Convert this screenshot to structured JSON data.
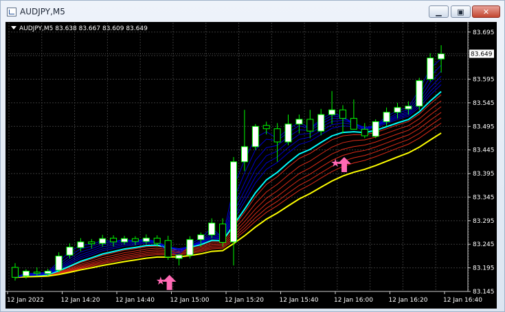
{
  "window": {
    "title": "AUDJPY,M5",
    "buttons": [
      "minimize",
      "maximize",
      "close"
    ]
  },
  "chart": {
    "info_text": "AUDJPY,M5  83.638 83.667 83.609 83.649",
    "current_price_label": "83.649"
  },
  "chart_data": {
    "type": "candlestick",
    "symbol": "AUDJPY",
    "timeframe": "M5",
    "ohlc_header": {
      "open": 83.638,
      "high": 83.667,
      "low": 83.609,
      "close": 83.649
    },
    "current_price": 83.649,
    "ylim": [
      83.145,
      83.715
    ],
    "y_ticks": [
      83.695,
      83.645,
      83.595,
      83.545,
      83.495,
      83.445,
      83.395,
      83.345,
      83.295,
      83.245,
      83.195,
      83.145
    ],
    "y_tick_labels": [
      "83.695",
      "83.595",
      "83.545",
      "83.495",
      "83.445",
      "83.395",
      "83.345",
      "83.295",
      "83.245",
      "83.195",
      "83.145"
    ],
    "x_tick_labels": [
      "12 Jan 2022",
      "12 Jan 14:20",
      "12 Jan 14:40",
      "12 Jan 15:00",
      "12 Jan 15:20",
      "12 Jan 15:40",
      "12 Jan 16:00",
      "12 Jan 16:20",
      "12 Jan 16:40"
    ],
    "x_tick_index": [
      0,
      5,
      10,
      15,
      20,
      25,
      30,
      35,
      40
    ],
    "candles": [
      {
        "o": 83.196,
        "h": 83.205,
        "l": 83.168,
        "c": 83.175
      },
      {
        "o": 83.178,
        "h": 83.192,
        "l": 83.172,
        "c": 83.188
      },
      {
        "o": 83.186,
        "h": 83.196,
        "l": 83.178,
        "c": 83.183
      },
      {
        "o": 83.183,
        "h": 83.193,
        "l": 83.178,
        "c": 83.188
      },
      {
        "o": 83.19,
        "h": 83.228,
        "l": 83.185,
        "c": 83.22
      },
      {
        "o": 83.222,
        "h": 83.247,
        "l": 83.215,
        "c": 83.239
      },
      {
        "o": 83.238,
        "h": 83.258,
        "l": 83.23,
        "c": 83.25
      },
      {
        "o": 83.25,
        "h": 83.256,
        "l": 83.236,
        "c": 83.246
      },
      {
        "o": 83.247,
        "h": 83.265,
        "l": 83.24,
        "c": 83.257
      },
      {
        "o": 83.258,
        "h": 83.264,
        "l": 83.24,
        "c": 83.25
      },
      {
        "o": 83.25,
        "h": 83.263,
        "l": 83.244,
        "c": 83.257
      },
      {
        "o": 83.257,
        "h": 83.262,
        "l": 83.243,
        "c": 83.251
      },
      {
        "o": 83.251,
        "h": 83.266,
        "l": 83.246,
        "c": 83.258
      },
      {
        "o": 83.258,
        "h": 83.264,
        "l": 83.24,
        "c": 83.247
      },
      {
        "o": 83.253,
        "h": 83.263,
        "l": 83.212,
        "c": 83.218
      },
      {
        "o": 83.215,
        "h": 83.224,
        "l": 83.2,
        "c": 83.222
      },
      {
        "o": 83.222,
        "h": 83.262,
        "l": 83.215,
        "c": 83.255
      },
      {
        "o": 83.255,
        "h": 83.27,
        "l": 83.24,
        "c": 83.265
      },
      {
        "o": 83.265,
        "h": 83.3,
        "l": 83.258,
        "c": 83.29
      },
      {
        "o": 83.288,
        "h": 83.3,
        "l": 83.24,
        "c": 83.249
      },
      {
        "o": 83.25,
        "h": 83.43,
        "l": 83.2,
        "c": 83.42
      },
      {
        "o": 83.42,
        "h": 83.53,
        "l": 83.4,
        "c": 83.452
      },
      {
        "o": 83.452,
        "h": 83.5,
        "l": 83.445,
        "c": 83.495
      },
      {
        "o": 83.497,
        "h": 83.505,
        "l": 83.478,
        "c": 83.49
      },
      {
        "o": 83.49,
        "h": 83.502,
        "l": 83.42,
        "c": 83.462
      },
      {
        "o": 83.462,
        "h": 83.52,
        "l": 83.455,
        "c": 83.5
      },
      {
        "o": 83.5,
        "h": 83.52,
        "l": 83.48,
        "c": 83.51
      },
      {
        "o": 83.51,
        "h": 83.53,
        "l": 83.47,
        "c": 83.485
      },
      {
        "o": 83.485,
        "h": 83.532,
        "l": 83.476,
        "c": 83.52
      },
      {
        "o": 83.52,
        "h": 83.57,
        "l": 83.5,
        "c": 83.53
      },
      {
        "o": 83.53,
        "h": 83.54,
        "l": 83.48,
        "c": 83.512
      },
      {
        "o": 83.512,
        "h": 83.552,
        "l": 83.49,
        "c": 83.489
      },
      {
        "o": 83.489,
        "h": 83.502,
        "l": 83.47,
        "c": 83.475
      },
      {
        "o": 83.474,
        "h": 83.51,
        "l": 83.47,
        "c": 83.505
      },
      {
        "o": 83.505,
        "h": 83.535,
        "l": 83.495,
        "c": 83.525
      },
      {
        "o": 83.525,
        "h": 83.545,
        "l": 83.512,
        "c": 83.535
      },
      {
        "o": 83.532,
        "h": 83.548,
        "l": 83.52,
        "c": 83.538
      },
      {
        "o": 83.538,
        "h": 83.598,
        "l": 83.53,
        "c": 83.592
      },
      {
        "o": 83.595,
        "h": 83.65,
        "l": 83.59,
        "c": 83.64
      },
      {
        "o": 83.638,
        "h": 83.667,
        "l": 83.609,
        "c": 83.649
      }
    ],
    "signals": [
      {
        "index": 14,
        "type": "buy-arrow",
        "price": 83.18
      },
      {
        "index": 30,
        "type": "buy-arrow",
        "price": 83.43
      }
    ],
    "colors": {
      "bull": "#ffffff",
      "bear": "#000000",
      "wick": "#00ff00",
      "grid": "#3a3a3a",
      "arrow": "#ff69b4",
      "fast_ma": "#0000cd",
      "aqua_ma": "#00ffff",
      "slow_ma": "#dc2b18",
      "yellow_ma": "#ffff00"
    },
    "grid": true
  }
}
